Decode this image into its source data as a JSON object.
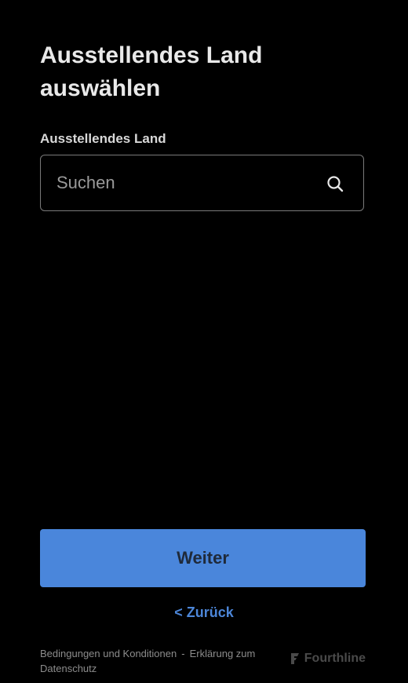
{
  "page": {
    "title": "Ausstellendes Land auswählen"
  },
  "country_field": {
    "label": "Ausstellendes Land",
    "placeholder": "Suchen",
    "value": ""
  },
  "actions": {
    "next_label": "Weiter",
    "back_label": "< Zurück"
  },
  "footer": {
    "terms_label": "Bedingungen und Konditionen",
    "separator": "-",
    "privacy_label": "Erklärung zum Datenschutz",
    "brand": "Fourthline"
  },
  "icons": {
    "search": "search-icon",
    "brand": "fourthline-logo-icon"
  },
  "colors": {
    "background": "#000000",
    "primary_button": "#4a86db",
    "link": "#4c86d8"
  }
}
